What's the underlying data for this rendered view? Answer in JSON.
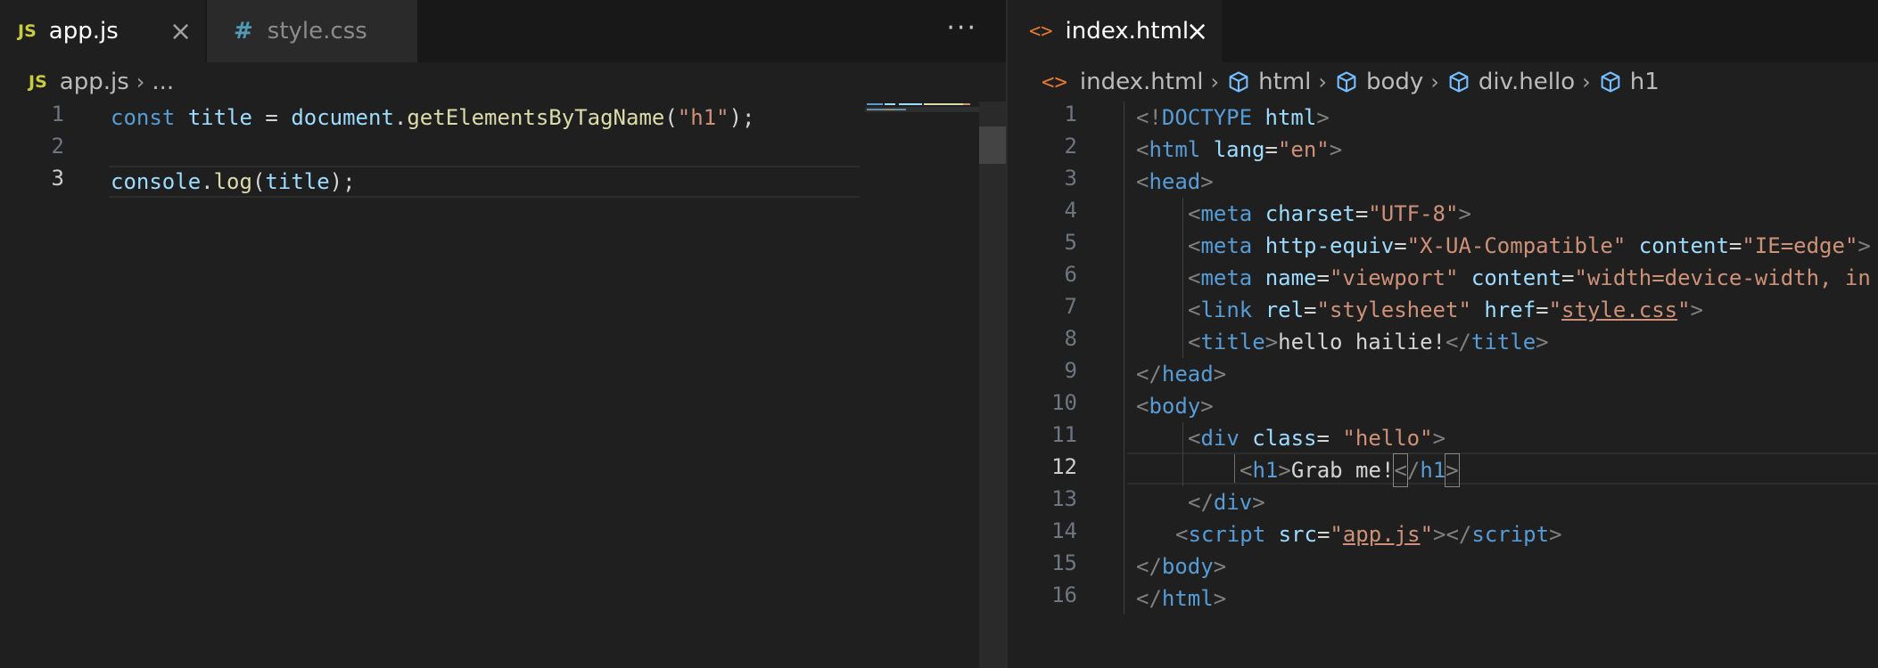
{
  "left": {
    "tabs": [
      {
        "icon": "JS",
        "label": "app.js",
        "active": true
      },
      {
        "icon": "#",
        "label": "style.css",
        "active": false
      }
    ],
    "more": "···",
    "breadcrumb": {
      "icon": "JS",
      "file": "app.js",
      "rest": "..."
    },
    "lines": [
      {
        "n": "1"
      },
      {
        "n": "2"
      },
      {
        "n": "3"
      }
    ],
    "code": {
      "l1": {
        "kw": "const",
        "var": "title",
        "eq": "=",
        "obj": "document",
        "dot": ".",
        "fn": "getElementsByTagName",
        "p1": "(",
        "str": "\"h1\"",
        "p2": ");"
      },
      "l3": {
        "obj": "console",
        "dot": ".",
        "fn": "log",
        "p1": "(",
        "arg": "title",
        "p2": ");"
      }
    }
  },
  "right": {
    "tab": {
      "icon": "<>",
      "label": "index.html"
    },
    "breadcrumb": [
      "index.html",
      "html",
      "body",
      "div.hello",
      "h1"
    ],
    "line_numbers": [
      "1",
      "2",
      "3",
      "4",
      "5",
      "6",
      "7",
      "8",
      "9",
      "10",
      "11",
      "12",
      "13",
      "14",
      "15",
      "16"
    ],
    "current_line": "12",
    "code": {
      "l1": {
        "a": "<!",
        "b": "DOCTYPE",
        "c": " html",
        "d": ">"
      },
      "l2": {
        "a": "<",
        "b": "html",
        "c": " lang",
        "d": "=",
        "e": "\"en\"",
        "f": ">"
      },
      "l3": {
        "a": "<",
        "b": "head",
        "c": ">"
      },
      "l4": {
        "a": "<",
        "b": "meta",
        "c": " charset",
        "d": "=",
        "e": "\"UTF-8\"",
        "f": ">"
      },
      "l5": {
        "a": "<",
        "b": "meta",
        "c": " http-equiv",
        "d": "=",
        "e": "\"X-UA-Compatible\"",
        "g": " content",
        "h": "=",
        "i": "\"IE=edge\"",
        "f": ">"
      },
      "l6": {
        "a": "<",
        "b": "meta",
        "c": " name",
        "d": "=",
        "e": "\"viewport\"",
        "g": " content",
        "h": "=",
        "i": "\"width=device-width, in"
      },
      "l7": {
        "a": "<",
        "b": "link",
        "c": " rel",
        "d": "=",
        "e": "\"stylesheet\"",
        "g": " href",
        "h": "=",
        "q1": "\"",
        "link": "style.css",
        "q2": "\"",
        "f": ">"
      },
      "l8": {
        "a": "<",
        "b": "title",
        "c": ">",
        "txt": "hello hailie!",
        "d": "</",
        "e": "title",
        "f": ">"
      },
      "l9": {
        "a": "</",
        "b": "head",
        "c": ">"
      },
      "l10": {
        "a": "<",
        "b": "body",
        "c": ">"
      },
      "l11": {
        "a": "<",
        "b": "div",
        "c": " class",
        "d": "= ",
        "e": "\"hello\"",
        "f": ">"
      },
      "l12": {
        "a": "<",
        "b": "h1",
        "c": ">",
        "txt": "Grab me!",
        "d": "<",
        "d2": "/",
        "e": "h1",
        "f": ">"
      },
      "l13": {
        "a": "</",
        "b": "div",
        "c": ">"
      },
      "l14": {
        "a": "<",
        "b": "script",
        "c": " src",
        "d": "=",
        "q1": "\"",
        "link": "app.js",
        "q2": "\"",
        "f": "></",
        "g": "script",
        "h": ">"
      },
      "l15": {
        "a": "</",
        "b": "body",
        "c": ">"
      },
      "l16": {
        "a": "</",
        "b": "html",
        "c": ">"
      }
    }
  },
  "colors": {
    "keyword": "#569cd6",
    "variable": "#9cdcfe",
    "function": "#dcdcaa",
    "string": "#ce9178",
    "js_icon": "#cbcb41",
    "css_icon": "#519aba",
    "html_icon": "#e37933"
  }
}
